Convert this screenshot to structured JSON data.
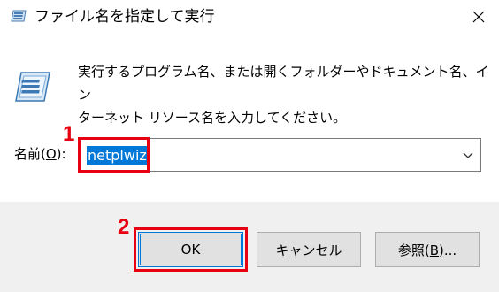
{
  "window": {
    "title": "ファイル名を指定して実行",
    "icon": "run-dialog-icon",
    "close_icon": "close-icon"
  },
  "dialog": {
    "description_line1": "実行するプログラム名、または開くフォルダーやドキュメント名、イン",
    "description_line2": "ターネット リソース名を入力してください。",
    "name_label_prefix": "名前(",
    "name_label_accel": "O",
    "name_label_suffix": "):",
    "name_value": "netplwiz"
  },
  "annotations": {
    "step1": "1",
    "step2": "2",
    "highlight_color": "#e60012"
  },
  "buttons": {
    "ok_label": "OK",
    "cancel_label": "キャンセル",
    "browse_prefix": "参照(",
    "browse_accel": "B",
    "browse_suffix": ")..."
  },
  "colors": {
    "selection": "#0078d7",
    "footer_bg": "#f0f0f0",
    "button_bg": "#e1e1e1"
  }
}
